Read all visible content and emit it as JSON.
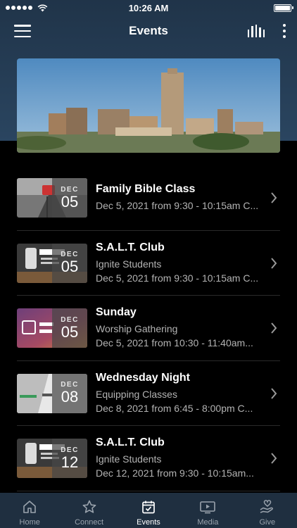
{
  "status_bar": {
    "time": "10:26 AM",
    "battery_level": 1.0
  },
  "header": {
    "title": "Events",
    "menu_icon": "hamburger-icon",
    "stats_icon": "bar-chart-icon",
    "more_icon": "vertical-dots-icon"
  },
  "hero": {
    "image": "city-skyline-photo"
  },
  "events": [
    {
      "title": "Family Bible Class",
      "month": "DEC",
      "day": "05",
      "subtitle": "",
      "datetime": "Dec 5, 2021 from 9:30 - 10:15am C...",
      "thumbnail": "route-66-sign"
    },
    {
      "title": "S.A.L.T. Club",
      "month": "DEC",
      "day": "05",
      "subtitle": "Ignite Students",
      "datetime": "Dec 5, 2021 from 9:30 - 10:15am C...",
      "thumbnail": "salt-club-graphic"
    },
    {
      "title": "Sunday",
      "month": "DEC",
      "day": "05",
      "subtitle": "Worship Gathering",
      "datetime": "Dec 5, 2021 from 10:30 - 11:40am...",
      "thumbnail": "worship-gathering-graphic"
    },
    {
      "title": "Wednesday Night",
      "month": "DEC",
      "day": "08",
      "subtitle": "Equipping Classes",
      "datetime": "Dec 8, 2021 from 6:45 - 8:00pm C...",
      "thumbnail": "equipping-graphic"
    },
    {
      "title": "S.A.L.T. Club",
      "month": "DEC",
      "day": "12",
      "subtitle": "Ignite Students",
      "datetime": "Dec 12, 2021 from 9:30 - 10:15am...",
      "thumbnail": "salt-club-graphic"
    }
  ],
  "tab_bar": {
    "tabs": [
      {
        "label": "Home",
        "icon": "home-icon",
        "active": false
      },
      {
        "label": "Connect",
        "icon": "star-icon",
        "active": false
      },
      {
        "label": "Events",
        "icon": "calendar-icon",
        "active": true
      },
      {
        "label": "Media",
        "icon": "play-icon",
        "active": false
      },
      {
        "label": "Give",
        "icon": "hand-heart-icon",
        "active": false
      }
    ]
  },
  "colors": {
    "header_bg": "#203449",
    "tab_bar_bg": "#1f2f40",
    "background": "#000000",
    "subtext": "#b3b3b3"
  }
}
